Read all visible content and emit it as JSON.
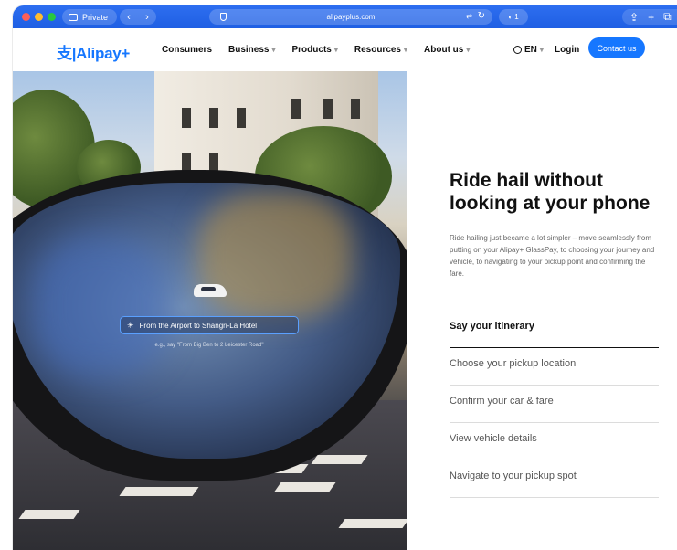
{
  "browser": {
    "private_label": "Private",
    "url": "alipayplus.com",
    "extension_badge": "1"
  },
  "nav": {
    "logo_text": "支|Alipay+",
    "menu": [
      {
        "label": "Consumers",
        "has_caret": false
      },
      {
        "label": "Business",
        "has_caret": true
      },
      {
        "label": "Products",
        "has_caret": true
      },
      {
        "label": "Resources",
        "has_caret": true
      },
      {
        "label": "About us",
        "has_caret": true
      }
    ],
    "language": "EN",
    "login": "Login",
    "contact": "Contact us"
  },
  "hero": {
    "prompt_text": "From the Airport to Shangri-La Hotel",
    "hint_text": "e.g., say \"From Big Ben to 2 Leicester Road\""
  },
  "content": {
    "headline": "Ride hail without looking at your phone",
    "description": "Ride hailing just became a lot simpler – move seamlessly from putting on your Alipay+ GlassPay, to choosing your journey and vehicle, to navigating to your pickup point and confirming the fare.",
    "steps": [
      {
        "label": "Say your itinerary",
        "active": true
      },
      {
        "label": "Choose your pickup location",
        "active": false
      },
      {
        "label": "Confirm your car & fare",
        "active": false
      },
      {
        "label": "View vehicle details",
        "active": false
      },
      {
        "label": "Navigate to your pickup spot",
        "active": false
      }
    ]
  },
  "colors": {
    "accent": "#1677ff",
    "chrome": "#2466ea"
  }
}
